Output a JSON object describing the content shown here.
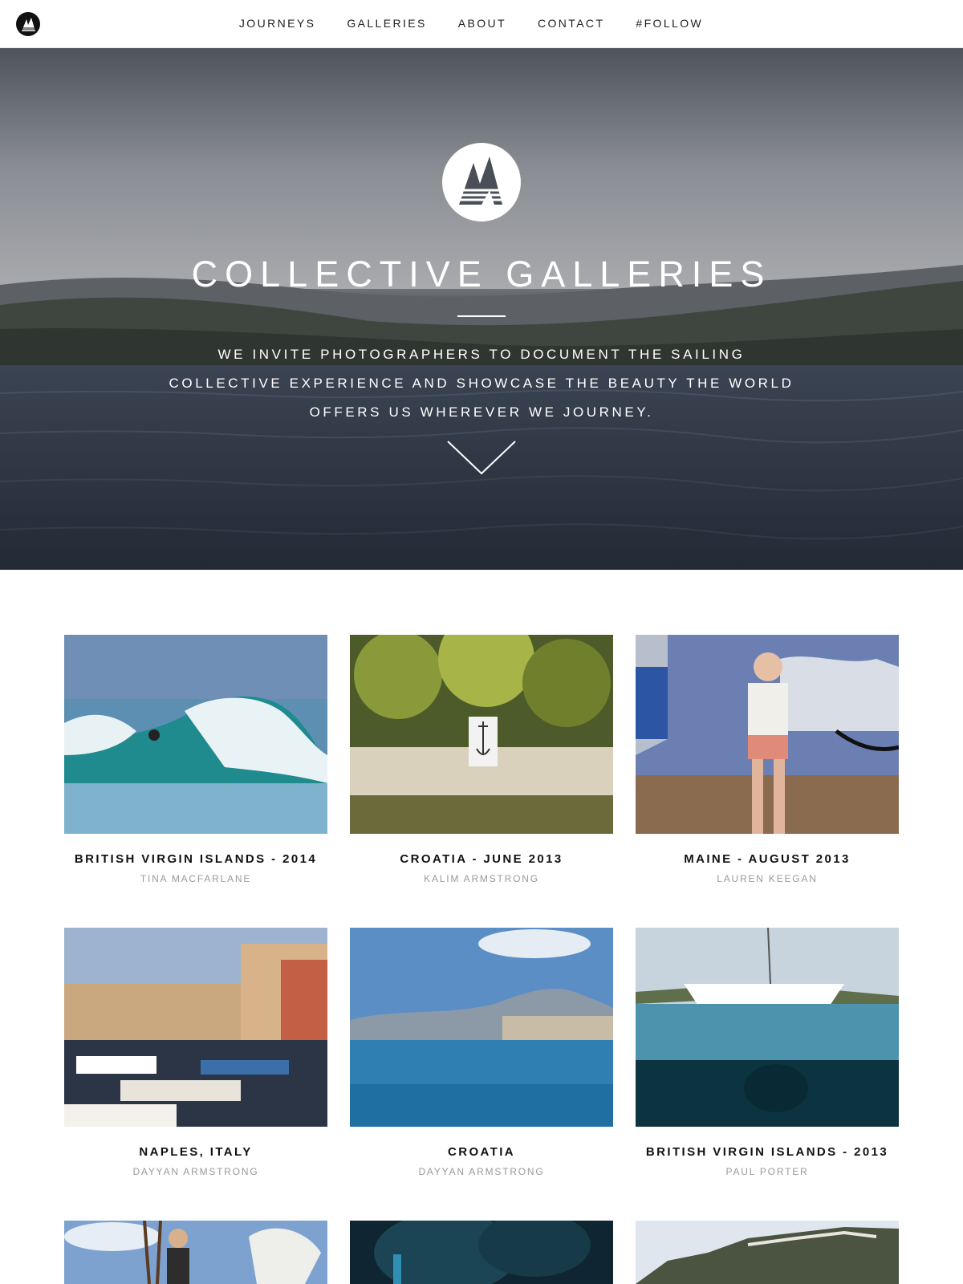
{
  "nav": {
    "items": [
      {
        "label": "JOURNEYS"
      },
      {
        "label": "GALLERIES"
      },
      {
        "label": "ABOUT"
      },
      {
        "label": "CONTACT"
      },
      {
        "label": "#FOLLOW"
      }
    ],
    "logo_icon": "sail-logo-icon"
  },
  "hero": {
    "title": "COLLECTIVE GALLERIES",
    "text": "WE INVITE PHOTOGRAPHERS TO DOCUMENT THE SAILING COLLECTIVE EXPERIENCE AND SHOWCASE THE BEAUTY THE WORLD OFFERS US WHEREVER WE JOURNEY.",
    "scroll_icon": "chevron-down-icon"
  },
  "galleries": [
    {
      "title": "BRITISH VIRGIN ISLANDS - 2014",
      "author": "TINA MACFARLANE"
    },
    {
      "title": "CROATIA - JUNE 2013",
      "author": "KALIM ARMSTRONG"
    },
    {
      "title": "MAINE - AUGUST 2013",
      "author": "LAUREN KEEGAN"
    },
    {
      "title": "NAPLES, ITALY",
      "author": "DAYYAN ARMSTRONG"
    },
    {
      "title": "CROATIA",
      "author": "DAYYAN ARMSTRONG"
    },
    {
      "title": "BRITISH VIRGIN ISLANDS -  2013",
      "author": "PAUL PORTER"
    }
  ],
  "colors": {
    "accent": "#111111",
    "muted": "#9a9a9a",
    "hero_overlay": "#2a3140"
  }
}
